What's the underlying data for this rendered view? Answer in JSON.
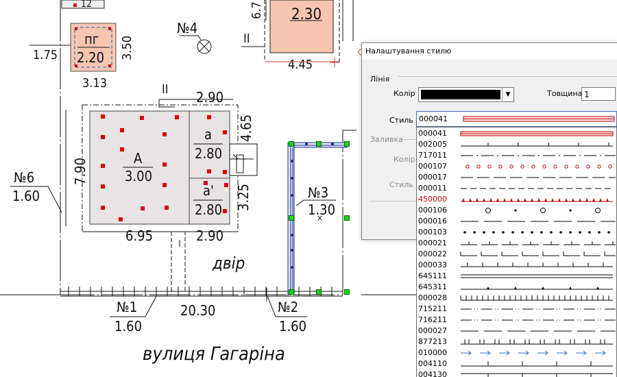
{
  "plan": {
    "labels": {
      "pg_top": "пг",
      "pg_bottom": "2.20",
      "pg_left_dim": "1.75",
      "pg_right_dim": "3.50",
      "pg_below_dim": "3.13",
      "top_building_number": "2.30",
      "top_building_side_dim": "6.7",
      "top_building_bottom_dim": "4.45",
      "top_cut_mark": "12",
      "well_number": "№4",
      "section_mark_top": "II",
      "section_mark_main": "II",
      "main_top_dim": "2.90",
      "main_left_dim": "7.90",
      "main_bottom_left_dim": "6.95",
      "main_bottom_right_dim": "2.90",
      "side_right_dim": "4.65",
      "side_right_dim2": "3.25",
      "building_a_letter": "А",
      "building_a_value": "3.00",
      "room_a_letter": "а",
      "room_a_value": "2.80",
      "room_a2_letter": "а'",
      "room_a2_value": "2.80",
      "n6_label": "№6",
      "n6_value": "1.60",
      "n3_label": "№3",
      "n3_value": "1.30",
      "yard": "двір",
      "n1_label": "№1",
      "n1_value": "1.60",
      "frontage": "20.30",
      "n2_label": "№2",
      "n2_value": "1.60",
      "street": "вулиця Гагаріна"
    }
  },
  "dialog": {
    "title": "Налаштування стилю",
    "section_line": "Лінія",
    "color_label": "Колір",
    "color_value": "#000000",
    "thickness_label": "Товщина",
    "thickness_value": "1",
    "style_label": "Стиль",
    "fill_section": "Заливка",
    "fill_color_label": "Колір",
    "fill_style_label": "Стиль",
    "selected_style": "000041"
  },
  "style_list": [
    {
      "code": "000041",
      "pattern": "double-red",
      "color": "#c00000"
    },
    {
      "code": "002005",
      "pattern": "long-tick",
      "color": "#000000"
    },
    {
      "code": "717011",
      "pattern": "dash-dot",
      "color": "#000000"
    },
    {
      "code": "000107",
      "pattern": "circles-red",
      "color": "#c00000"
    },
    {
      "code": "000017",
      "pattern": "dash",
      "color": "#000000"
    },
    {
      "code": "000011",
      "pattern": "short-dash",
      "color": "#000000"
    },
    {
      "code": "450000",
      "pattern": "red-teeth",
      "color": "#c00000",
      "text_color": "#c00000"
    },
    {
      "code": "000106",
      "pattern": "circle-dot",
      "color": "#000000"
    },
    {
      "code": "000016",
      "pattern": "long-dash",
      "color": "#000000"
    },
    {
      "code": "000103",
      "pattern": "dots",
      "color": "#000000"
    },
    {
      "code": "000021",
      "pattern": "dash-tick",
      "color": "#000000"
    },
    {
      "code": "000022",
      "pattern": "tick-dash",
      "color": "#000000"
    },
    {
      "code": "000033",
      "pattern": "tick-up",
      "color": "#000000"
    },
    {
      "code": "645111",
      "pattern": "double-line",
      "color": "#000000"
    },
    {
      "code": "645311",
      "pattern": "triangles",
      "color": "#000000"
    },
    {
      "code": "000028",
      "pattern": "dense-ticks",
      "color": "#000000"
    },
    {
      "code": "715211",
      "pattern": "dash-dot-dot",
      "color": "#000000"
    },
    {
      "code": "716211",
      "pattern": "dash-dot-dot2",
      "color": "#000000"
    },
    {
      "code": "000027",
      "pattern": "long-dash2",
      "color": "#000000"
    },
    {
      "code": "877213",
      "pattern": "tick-pairs",
      "color": "#000000"
    },
    {
      "code": "010000",
      "pattern": "arrows",
      "color": "#1f77d0"
    },
    {
      "code": "004110",
      "pattern": "sparse-ticks",
      "color": "#000000"
    },
    {
      "code": "004130",
      "pattern": "tall-ticks",
      "color": "#000000"
    }
  ]
}
